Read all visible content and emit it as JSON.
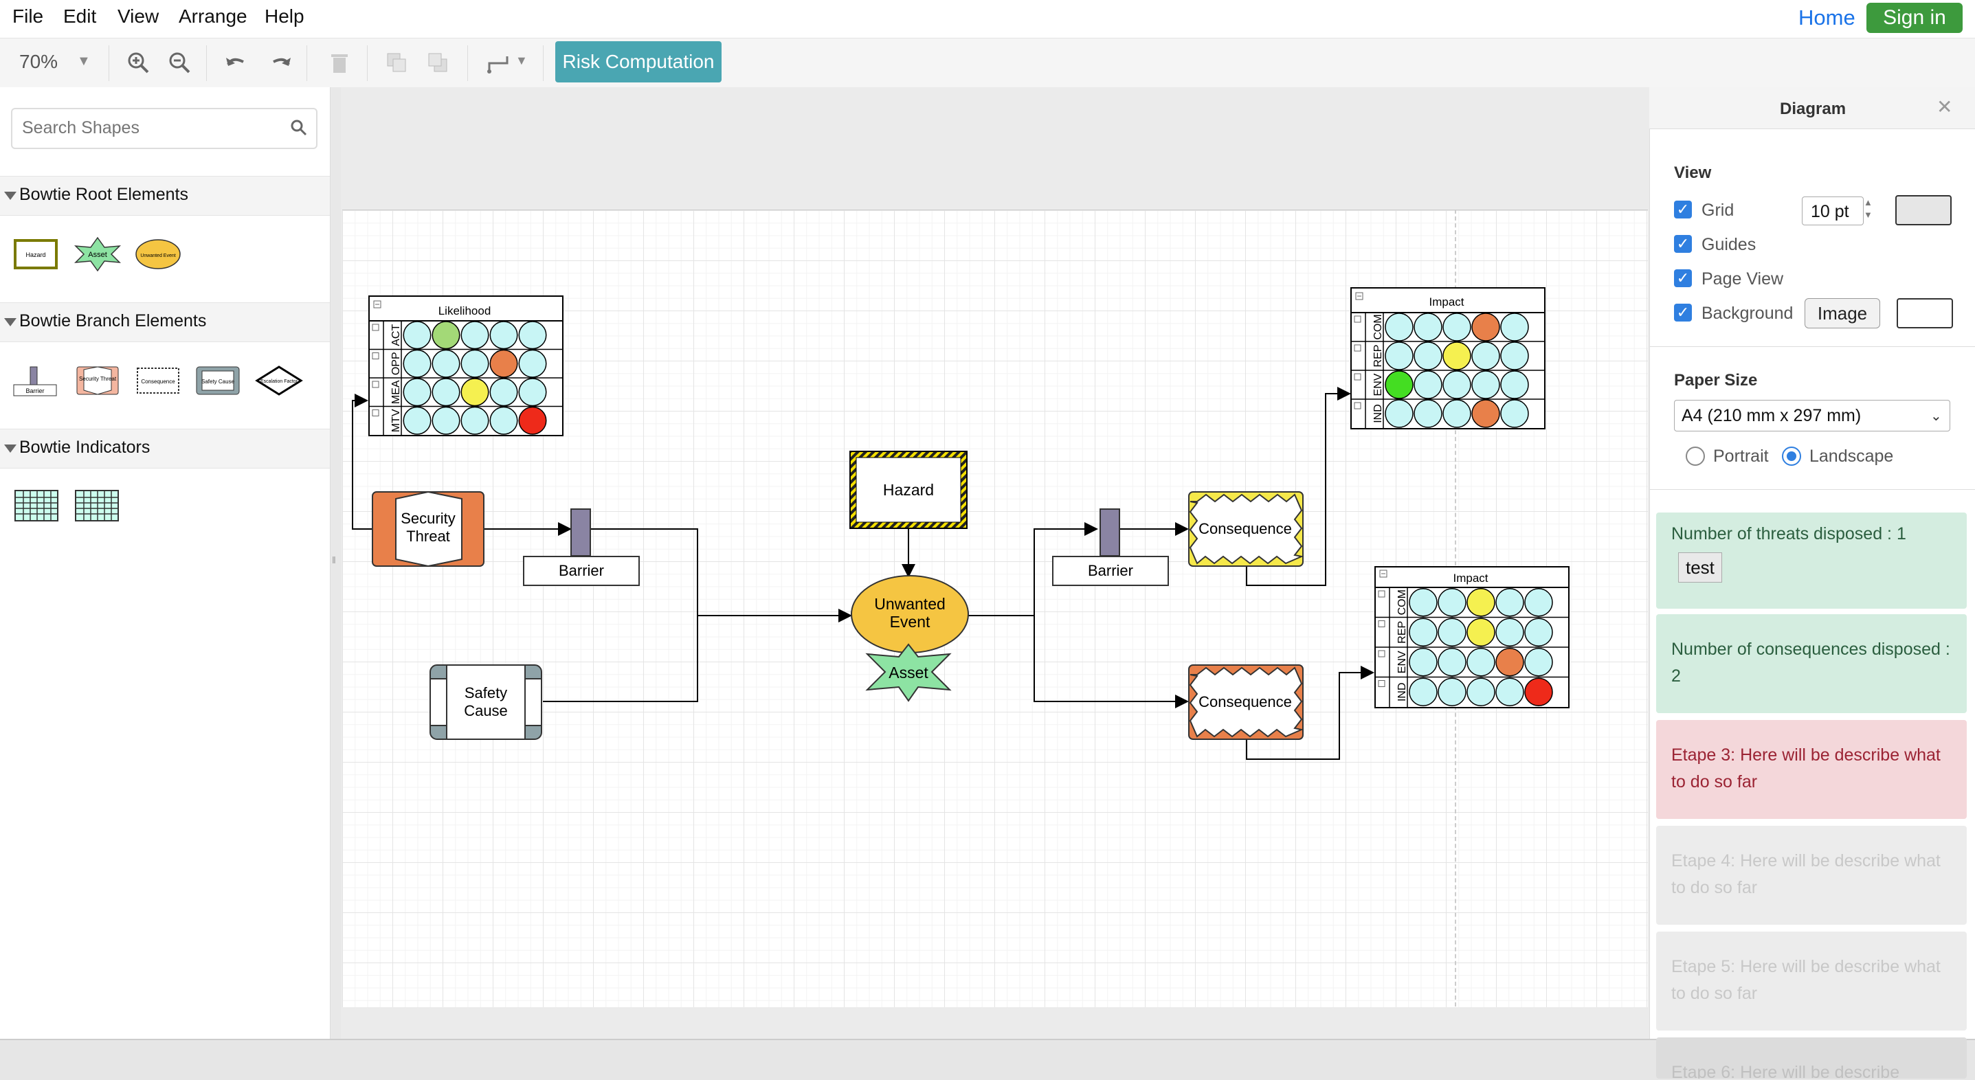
{
  "menu": {
    "file": "File",
    "edit": "Edit",
    "view": "View",
    "arrange": "Arrange",
    "help": "Help"
  },
  "topright": {
    "home": "Home",
    "signin": "Sign in"
  },
  "toolbar": {
    "zoom": "70%",
    "risk_button": "Risk Computation"
  },
  "sidebar": {
    "search_placeholder": "Search Shapes",
    "sections": [
      "Bowtie Root Elements",
      "Bowtie Branch Elements",
      "Bowtie Indicators"
    ],
    "root_shapes": [
      "Hazard",
      "Asset",
      "Unwanted Event"
    ],
    "branch_shapes": [
      "Barrier",
      "Security Threat",
      "Consequence",
      "Safety Cause",
      "Escalation Factor"
    ]
  },
  "diagram": {
    "likelihood": {
      "title": "Likelihood",
      "rows": [
        "ACT",
        "OPP",
        "MEA",
        "MTV"
      ]
    },
    "impact_top": {
      "title": "Impact",
      "rows": [
        "COM",
        "REP",
        "ENV",
        "IND"
      ]
    },
    "impact_bottom": {
      "title": "Impact",
      "rows": [
        "COM",
        "REP",
        "ENV",
        "IND"
      ]
    },
    "security_threat": "Security Threat",
    "safety_cause": "Safety Cause",
    "barrier_left": "Barrier",
    "barrier_right": "Barrier",
    "hazard": "Hazard",
    "unwanted_event": "Unwanted Event",
    "asset": "Asset",
    "consequence_top": "Consequence",
    "consequence_bottom": "Consequence"
  },
  "panel": {
    "title": "Diagram",
    "view_heading": "View",
    "grid": "Grid",
    "grid_size": "10 pt",
    "guides": "Guides",
    "page_view": "Page View",
    "background": "Background",
    "image_button": "Image",
    "paper_size_heading": "Paper Size",
    "paper_size": "A4 (210 mm x 297 mm)",
    "portrait": "Portrait",
    "landscape": "Landscape",
    "orientation": "Landscape"
  },
  "cards": {
    "threats": "Number of threats disposed : 1",
    "test_button": "test",
    "consequences": "Number of consequences disposed : 2",
    "etape3": "Etape 3: Here will be describe what to do so far",
    "etape4": "Etape 4: Here will be describe what to do so far",
    "etape5": "Etape 5: Here will be describe what to do so far",
    "etape6": "Etape 6: Here will be describe"
  },
  "colors": {
    "accent": "#4aa6b2",
    "signin": "#3d9a3d",
    "card_green_bg": "#d4ede0",
    "card_red_bg": "#f4d7da",
    "card_grey_bg": "#ececec",
    "threat": "#e8804a",
    "unwanted_event": "#f5c542",
    "asset": "#8de3a3",
    "barrier": "#8a84a3"
  }
}
